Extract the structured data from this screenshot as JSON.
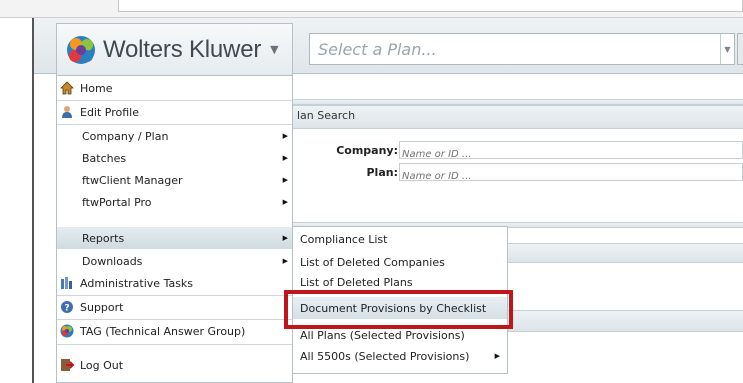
{
  "brand": {
    "name": "Wolters Kluwer",
    "caret": "▼"
  },
  "plan_select": {
    "placeholder": "Select a Plan..."
  },
  "search_panel": {
    "title": "lan Search",
    "company_label": "Company:",
    "company_placeholder": "Name or ID ...",
    "plan_label": "Plan:",
    "plan_placeholder": "Name or ID ..."
  },
  "menu": {
    "items": [
      {
        "label": "Home",
        "icon": "home-icon"
      },
      {
        "label": "Edit Profile",
        "icon": "user-icon"
      },
      {
        "label": "Company / Plan",
        "submenu": true
      },
      {
        "label": "Batches",
        "submenu": true
      },
      {
        "label": "ftwClient Manager",
        "submenu": true
      },
      {
        "label": "ftwPortal Pro",
        "submenu": true
      },
      {
        "label": "Reports",
        "submenu": true
      },
      {
        "label": "Downloads",
        "submenu": true
      },
      {
        "label": "Administrative Tasks",
        "icon": "admin-tasks-icon"
      },
      {
        "label": "Support",
        "icon": "support-icon"
      },
      {
        "label": "TAG (Technical Answer Group)",
        "icon": "tag-icon"
      },
      {
        "label": "Log Out",
        "icon": "logout-icon"
      }
    ]
  },
  "reports_submenu": {
    "items": [
      {
        "label": "Compliance List"
      },
      {
        "label": "List of Deleted Companies"
      },
      {
        "label": "List of Deleted Plans"
      },
      {
        "label": "Document Provisions by Checklist"
      },
      {
        "label": "All Plans (Selected Provisions)"
      },
      {
        "label": "All 5500s (Selected Provisions)",
        "submenu": true
      }
    ]
  },
  "colors": {
    "highlight": "#c0161b",
    "hover": "#d4e0e6"
  }
}
